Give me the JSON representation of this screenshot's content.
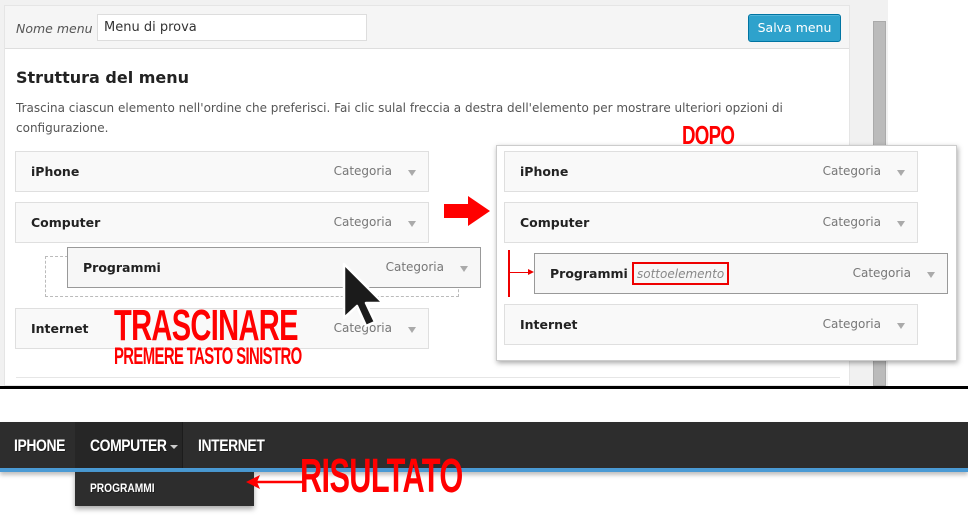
{
  "editor": {
    "menu_name_label": "Nome menu",
    "menu_name_value": "Menu di prova",
    "save_label": "Salva menu",
    "structure_title": "Struttura del menu",
    "instructions": "Trascina ciascun elemento nell'ordine che preferisci. Fai clic sulal freccia a destra dell'elemento per mostrare ulteriori opzioni di configurazione.",
    "before_items": [
      {
        "title": "iPhone",
        "type": "Categoria"
      },
      {
        "title": "Computer",
        "type": "Categoria"
      },
      {
        "title": "Programmi",
        "type": "Categoria",
        "state": "dragging"
      },
      {
        "title": "Internet",
        "type": "Categoria"
      }
    ],
    "after_items": [
      {
        "title": "iPhone",
        "type": "Categoria"
      },
      {
        "title": "Computer",
        "type": "Categoria"
      },
      {
        "title": "Programmi",
        "type": "Categoria",
        "badge": "sottoelemento"
      },
      {
        "title": "Internet",
        "type": "Categoria"
      }
    ]
  },
  "annotations": {
    "after": "DOPO",
    "drag": "TRASCINARE",
    "drag_hint": "PREMERE TASTO SINISTRO",
    "result": "RISULTATO",
    "accent_color": "#ff0000"
  },
  "navbar": {
    "items": [
      "IPHONE",
      "COMPUTER",
      "INTERNET"
    ],
    "dropdown_items": [
      "PROGRAMMI"
    ],
    "background": "#2d2d2d",
    "accent": "#4a9ad4"
  },
  "colors": {
    "save_button": "#2ea2cc"
  }
}
